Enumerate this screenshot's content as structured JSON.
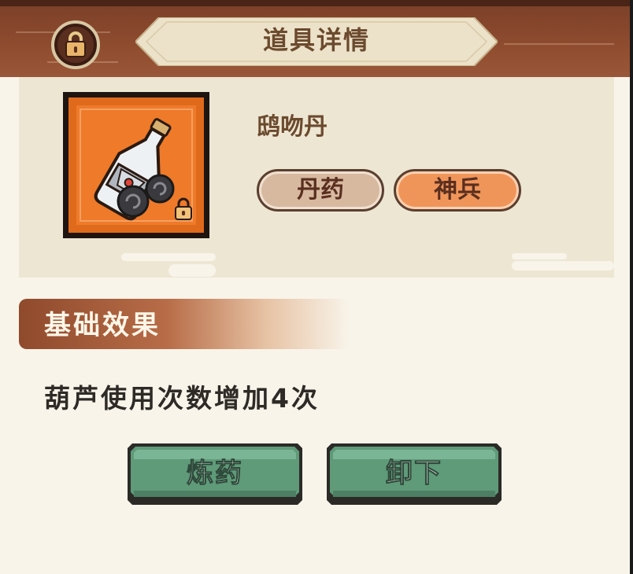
{
  "header": {
    "title": "道具详情",
    "lock_icon": "lock-icon"
  },
  "item": {
    "name": "鸱吻丹",
    "icon": "potion-bottle-icon",
    "badge_icon": "lock-icon",
    "tags": [
      "丹药",
      "神兵"
    ]
  },
  "section": {
    "title": "基础效果",
    "effect": "葫芦使用次数增加4次"
  },
  "actions": {
    "refine_label": "炼药",
    "unequip_label": "卸下"
  },
  "colors": {
    "header_brown": "#8f4c2f",
    "panel_bg": "#f8f4ea",
    "item_frame_orange": "#ee7a2a",
    "button_green": "#5f9a79",
    "tag_light": "#d7b9a0",
    "tag_orange": "#f0955a"
  }
}
